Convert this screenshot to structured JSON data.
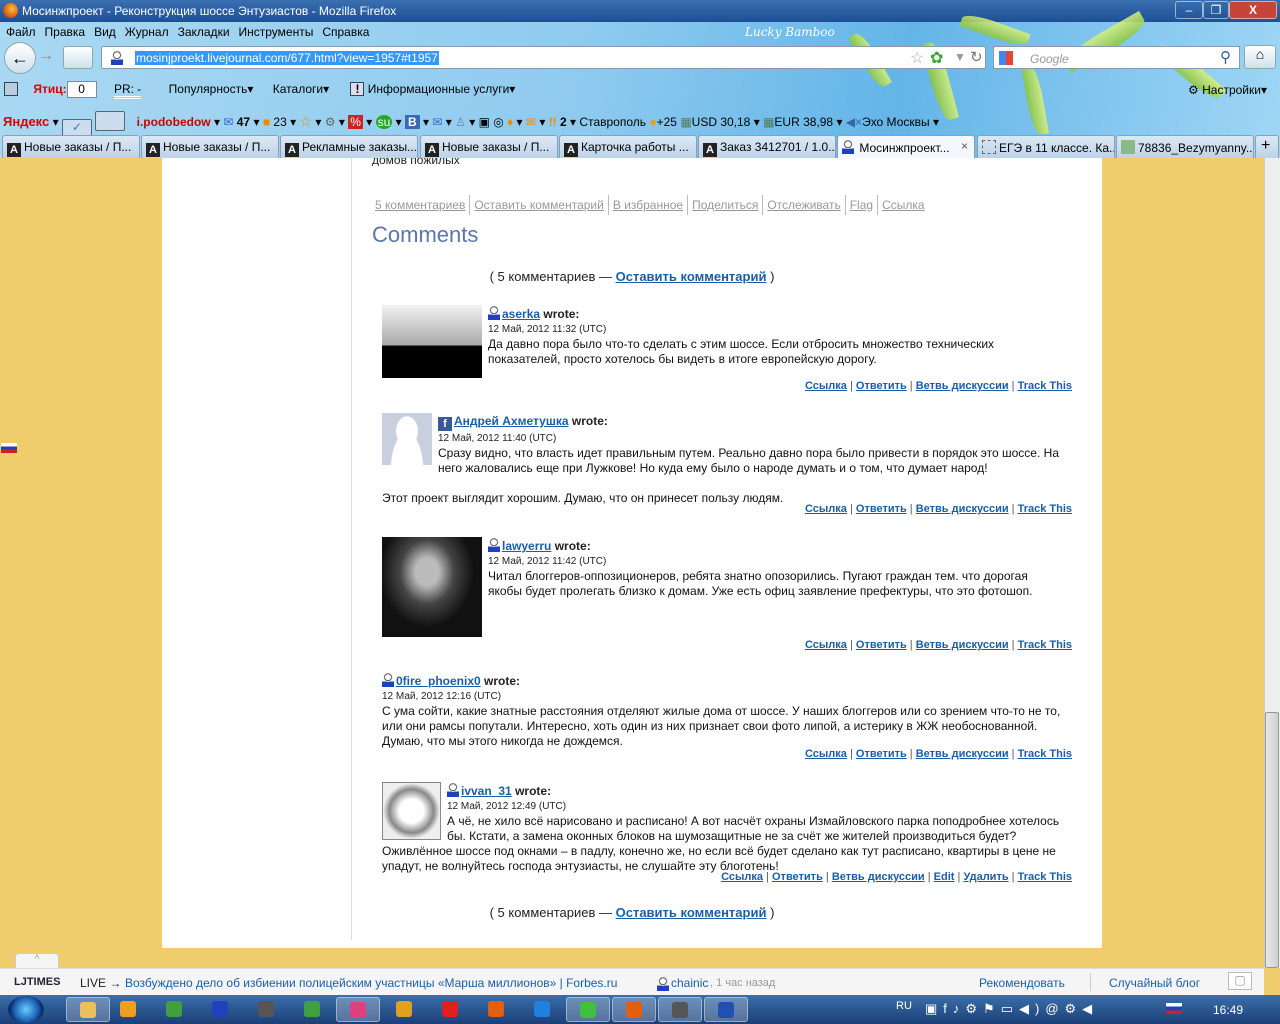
{
  "window": {
    "title": "Мосинжпроект - Реконструкция шоссе Энтузиастов - Mozilla Firefox",
    "theme": "Lucky Bamboo",
    "min": "‒",
    "max": "❐",
    "close": "X"
  },
  "menu": [
    {
      "label": "Файл"
    },
    {
      "label": "Правка"
    },
    {
      "label": "Вид"
    },
    {
      "label": "Журнал"
    },
    {
      "label": "Закладки"
    },
    {
      "label": "Инструменты"
    },
    {
      "label": "Справка"
    }
  ],
  "nav": {
    "url": "mosinjproekt.livejournal.com/677.html?view=1957#t1957",
    "search_placeholder": "Google"
  },
  "toolbar1": {
    "tic_label": "Ятиц:",
    "tic_value": "0",
    "pr": "PR: -",
    "popularity": "Популярность",
    "catalogs": "Каталоги",
    "info": "Информационные услуги",
    "settings": "Настройки"
  },
  "toolbar2": {
    "yandex": "Яндекс",
    "user": "i.podobedow",
    "mail_count": "47",
    "count2": "23",
    "count3": "2",
    "city": "Ставрополь",
    "temp": "+25",
    "usd": "USD 30,18",
    "eur": "EUR 38,98",
    "radio": "Эхо Москвы"
  },
  "tabs": [
    {
      "label": "Новые заказы / П..."
    },
    {
      "label": "Новые заказы / П..."
    },
    {
      "label": "Рекламные заказы..."
    },
    {
      "label": "Новые заказы / П..."
    },
    {
      "label": "Карточка работы ..."
    },
    {
      "label": "Заказ 3412701 / 1.0..."
    },
    {
      "label": "Мосинжпроект...",
      "active": true
    },
    {
      "label": "ЕГЭ в 11 классе. Ка..."
    },
    {
      "label": "78836_Bezymyanny..."
    }
  ],
  "post": {
    "cut_text": "домов пожилых",
    "links": [
      "5 комментариев",
      "Оставить комментарий",
      "В избранное",
      "Поделиться",
      "Отслеживать",
      "Flag",
      "Ссылка"
    ],
    "comments_heading": "Comments",
    "count_text": "( 5 комментариев — ",
    "leave": "Оставить комментарий",
    "close_paren": " )"
  },
  "comments": [
    {
      "user": "aserka",
      "wrote": "wrote:",
      "date": "12 Май, 2012 11:32 (UTC)",
      "text": "Да давно пора было что-то сделать с этим шоссе. Если отбросить множество технических показателей, просто хотелось бы видеть в итоге европейскую дорогу.",
      "links": [
        "Ссылка",
        "Ответить",
        "Ветвь дискуссии",
        "Track This"
      ]
    },
    {
      "user": "Андрей Ахметушка",
      "wrote": "wrote:",
      "date": "12 Май, 2012 11:40 (UTC)",
      "text": "Сразу видно, что власть идет правильным путем. Реально давно пора было привести в порядок это шоссе. На него жаловались еще при Лужкове! Но куда ему было о народе думать и о том, что думает народ!",
      "text2": "Этот проект выглядит хорошим. Думаю, что он принесет пользу людям.",
      "links": [
        "Ссылка",
        "Ответить",
        "Ветвь дискуссии",
        "Track This"
      ]
    },
    {
      "user": "lawyerru",
      "wrote": "wrote:",
      "date": "12 Май, 2012 11:42 (UTC)",
      "text": "Читал блоггеров-оппозиционеров, ребята знатно опозорились. Пугают граждан тем. что дорогая якобы будет пролегать близко к домам. Уже есть офиц заявление префектуры, что это фотошоп.",
      "links": [
        "Ссылка",
        "Ответить",
        "Ветвь дискуссии",
        "Track This"
      ]
    },
    {
      "user": "0fire_phoenix0",
      "wrote": "wrote:",
      "date": "12 Май, 2012 12:16 (UTC)",
      "text": "С ума сойти, какие знатные расстояния отделяют жилые дома от шоссе. У наших блоггеров или со зрением что-то не то, или они рамсы попутали. Интересно, хоть один из них признает свои фото липой, а истерику в ЖЖ необоснованной. Думаю, что мы этого никогда не дождемся.",
      "links": [
        "Ссылка",
        "Ответить",
        "Ветвь дискуссии",
        "Track This"
      ]
    },
    {
      "user": "ivvan_31",
      "wrote": "wrote:",
      "date": "12 Май, 2012 12:49 (UTC)",
      "text": "А чё, не хило всё нарисовано и расписано! А вот насчёт охраны Измайловского парка поподробнее хотелось бы. Кстати, а замена оконных блоков на шумозащитные не за счёт же жителей производиться будет? Оживлённое шоссе под окнами – в падлу, конечно же, но если всё будет сделано как тут расписано, квартиры в цене не упадут, не волнуйтесь господа энтузиасты, не слушайте эту блоготень!",
      "links": [
        "Ссылка",
        "Ответить",
        "Ветвь дискуссии",
        "Edit",
        "Удалить",
        "Track This"
      ]
    }
  ],
  "ljtimes": {
    "logo": "LJTIMES",
    "live": "LIVE →",
    "headline": "Возбуждено дело об избиении полицейским участницы «Марша миллионов» | Forbes.ru",
    "user": "chainic",
    "ago": ", 1 час назад",
    "recommend": "Рекомендовать",
    "random": "Случайный блог"
  },
  "taskbar": {
    "lang": "RU",
    "clock": "16:49",
    "apps": [
      {
        "name": "explorer",
        "color": "#e8c060"
      },
      {
        "name": "app-i",
        "color": "#f0a020"
      },
      {
        "name": "app-chart",
        "color": "#40a040"
      },
      {
        "name": "app-save",
        "color": "#2040c0"
      },
      {
        "name": "app-printer",
        "color": "#555"
      },
      {
        "name": "chrome",
        "color": "#40a040"
      },
      {
        "name": "picasa",
        "color": "#e04080"
      },
      {
        "name": "chromium",
        "color": "#e0a020"
      },
      {
        "name": "opera",
        "color": "#e02020"
      },
      {
        "name": "firefox",
        "color": "#e06010"
      },
      {
        "name": "app-m",
        "color": "#2080e0"
      },
      {
        "name": "icq",
        "color": "#40c040"
      },
      {
        "name": "firefox-2",
        "color": "#e06010"
      },
      {
        "name": "app-printer-2",
        "color": "#555"
      },
      {
        "name": "word",
        "color": "#2050b0"
      }
    ]
  }
}
